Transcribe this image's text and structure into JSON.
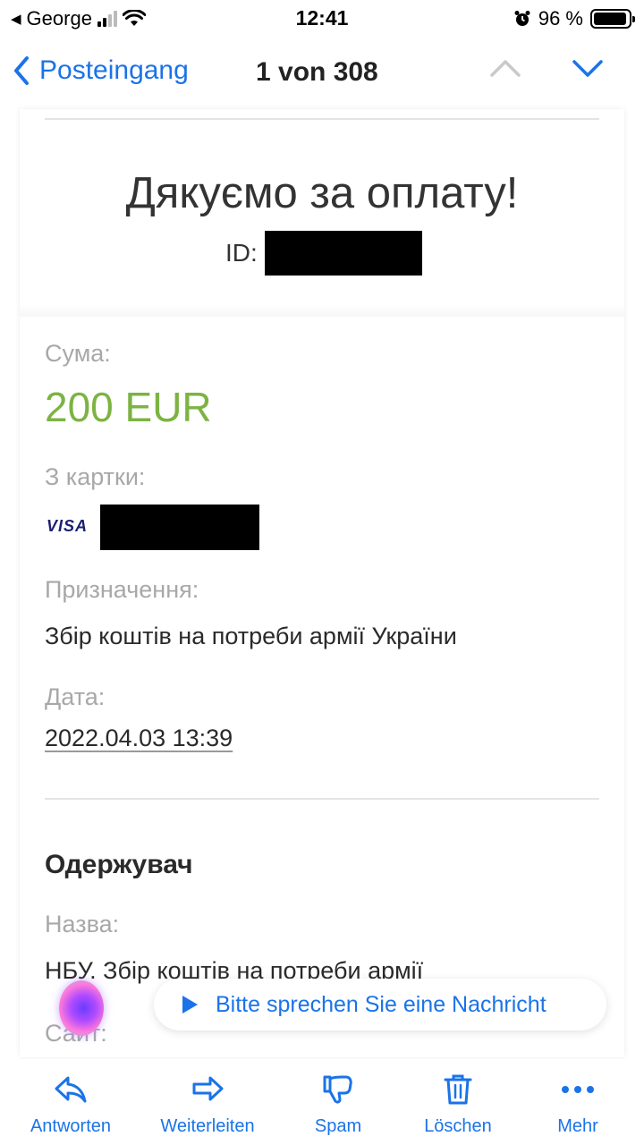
{
  "status_bar": {
    "carrier": "George",
    "time": "12:41",
    "battery_percent": "96 %",
    "battery_level": 0.96
  },
  "nav": {
    "back_label": "Posteingang",
    "message_count": "1 von 308"
  },
  "email": {
    "title": "Дякуємо за оплату!",
    "id_label": "ID:",
    "amount_label": "Сума:",
    "amount_value": "200 EUR",
    "card_label": "З картки:",
    "card_brand": "VISA",
    "purpose_label": "Призначення:",
    "purpose_value": "Збір коштів на потреби армії України",
    "date_label": "Дата:",
    "date_value": "2022.04.03 13:39",
    "recipient_heading": "Одержувач",
    "name_label": "Назва:",
    "name_value": "НБУ. Збір коштів на потреби армії",
    "site_label": "Сайт:"
  },
  "siri": {
    "prompt": "Bitte sprechen Sie eine Nachricht"
  },
  "toolbar": {
    "reply": "Antworten",
    "forward": "Weiterleiten",
    "spam": "Spam",
    "delete": "Löschen",
    "more": "Mehr"
  },
  "colors": {
    "accent": "#1a73e8",
    "amount": "#7cb342",
    "label": "#a8a8a8"
  }
}
